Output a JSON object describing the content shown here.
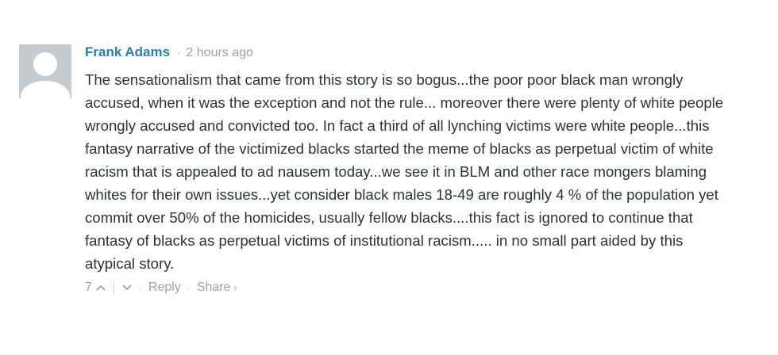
{
  "comment": {
    "author": "Frank Adams",
    "separator": "·",
    "timestamp": "2 hours ago",
    "message": "The sensationalism that came from this story is so bogus...the poor poor black man wrongly accused, when it was the exception and not the rule... moreover there were plenty of white people wrongly accused and convicted too. In fact a third of all lynching victims were white people...this fantasy narrative of the victimized blacks started the meme of blacks as perpetual victim of white racism that is appealed to ad nausem today...we see it in BLM and other race mongers blaming whites for their own issues...yet consider black males 18-49 are roughly 4 % of the population yet commit over 50% of the homicides, usually fellow blacks....this fact is ignored to continue that fantasy of blacks as perpetual victims of institutional racism..... in no small part aided by this atypical story.",
    "footer": {
      "upvote_count": "7",
      "dot": "·",
      "reply_label": "Reply",
      "share_label": "Share",
      "share_chevron": "›"
    }
  },
  "icons": {
    "avatar": "default-user-avatar",
    "upvote": "chevron-up-icon",
    "downvote": "chevron-down-icon"
  },
  "colors": {
    "author": "#2a7fae",
    "meta": "#9aa3aa",
    "text": "#2c3338",
    "avatar_bg": "#c6cbd0",
    "avatar_fg": "#ffffff"
  }
}
